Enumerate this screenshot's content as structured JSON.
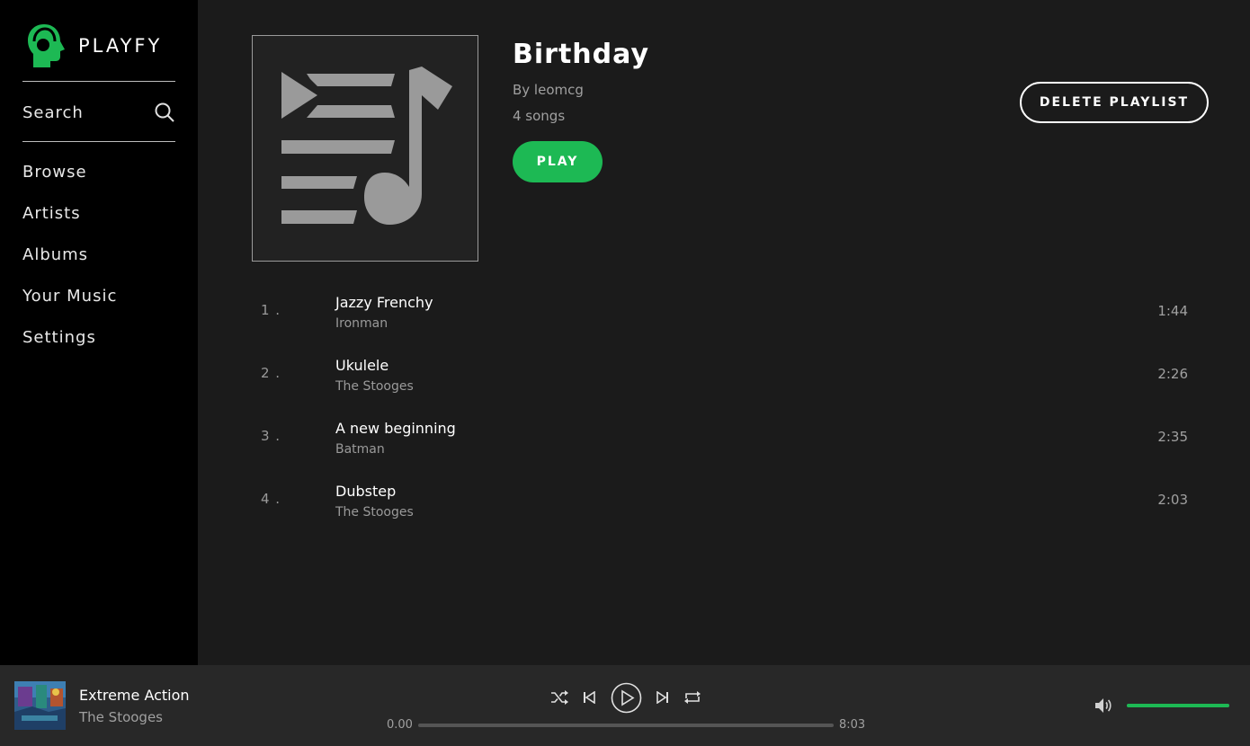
{
  "brand": {
    "name": "PLAYFY",
    "accent": "#1db954"
  },
  "sidebar": {
    "search_label": "Search",
    "nav": [
      {
        "label": "Browse"
      },
      {
        "label": "Artists"
      },
      {
        "label": "Albums"
      },
      {
        "label": "Your Music"
      },
      {
        "label": "Settings"
      }
    ]
  },
  "playlist": {
    "title": "Birthday",
    "owner": "By leomcg",
    "song_count": "4 songs",
    "play_label": "PLAY",
    "delete_label": "DELETE PLAYLIST",
    "cover_icon": "playlist-music-icon",
    "tracks": [
      {
        "num": "1 .",
        "name": "Jazzy Frenchy",
        "artist": "Ironman",
        "duration": "1:44"
      },
      {
        "num": "2 .",
        "name": "Ukulele",
        "artist": "The Stooges",
        "duration": "2:26"
      },
      {
        "num": "3 .",
        "name": "A new beginning",
        "artist": "Batman",
        "duration": "2:35"
      },
      {
        "num": "4 .",
        "name": "Dubstep",
        "artist": "The Stooges",
        "duration": "2:03"
      }
    ]
  },
  "player": {
    "title": "Extreme Action",
    "artist": "The Stooges",
    "time_current": "0.00",
    "time_total": "8:03",
    "progress": 0,
    "volume": 1.0,
    "icons": [
      "shuffle-icon",
      "previous-icon",
      "play-icon",
      "next-icon",
      "repeat-icon",
      "volume-icon"
    ]
  }
}
